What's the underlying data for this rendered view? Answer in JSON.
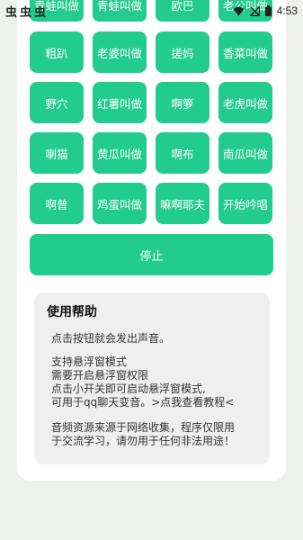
{
  "status_bar": {
    "left_icons": [
      "虫",
      "虫",
      "虫"
    ],
    "time": "4:53",
    "icons": [
      "wifi-icon",
      "signal-icon",
      "battery-icon"
    ]
  },
  "top_row": [
    "青蛙叫做",
    "青蛙叫做",
    "欧巴",
    "老公叫做"
  ],
  "rows": [
    [
      "粗趴",
      "老婆叫做",
      "搓妈",
      "香菜叫做"
    ],
    [
      "野穴",
      "红薯叫做",
      "啊箩",
      "老虎叫做"
    ],
    [
      "喇猫",
      "黄瓜叫做",
      "啊布",
      "南瓜叫做"
    ],
    [
      "啊普",
      "鸡蛋叫做",
      "嘛啊耶夫",
      "开始吟唱"
    ]
  ],
  "stop_label": "停止",
  "help": {
    "title": "使用帮助",
    "lines": [
      "点击按钮就会发出声音。",
      "支持悬浮窗模式",
      "需要开启悬浮窗权限",
      "点击小开关即可启动悬浮窗模式,",
      "可用于qq聊天变音。>点我查看教程<",
      "音频资源来源于网络收集，程序仅限用",
      "于交流学习，请勿用于任何非法用途！"
    ]
  },
  "colors": {
    "accent": "#22cb8e",
    "background": "#eef0ee",
    "help_bg": "#efefef"
  }
}
